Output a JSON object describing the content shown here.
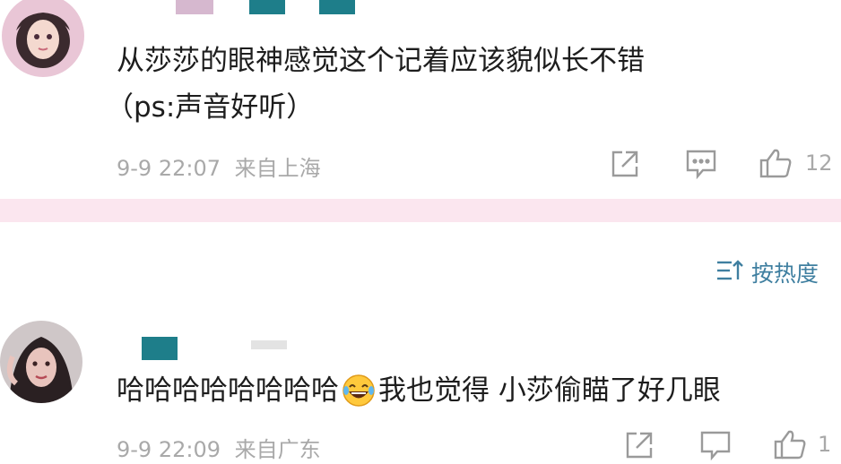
{
  "comments": [
    {
      "text_line1": "从莎莎的眼神感觉这个记着应该貌似长不错",
      "text_line2": "（ps:声音好听）",
      "timestamp": "9-9 22:07",
      "location": "来自上海",
      "like_count": "12"
    },
    {
      "text_before_emoji": "哈哈哈哈哈哈哈哈",
      "emoji": "laughing-tears-emoji",
      "text_after_emoji": "我也觉得 小莎偷瞄了好几眼",
      "timestamp": "9-9 22:09",
      "location": "来自广东",
      "like_count": "1"
    }
  ],
  "sort": {
    "label": "按热度",
    "icon": "sort-icon"
  },
  "icons": [
    "share-icon",
    "comment-icon",
    "like-icon"
  ],
  "colors": {
    "divider": "#fbe6ef",
    "meta_text": "#a9a9a9",
    "accent": "#3f7fa0",
    "name_redaction": "#1e7e8a"
  }
}
